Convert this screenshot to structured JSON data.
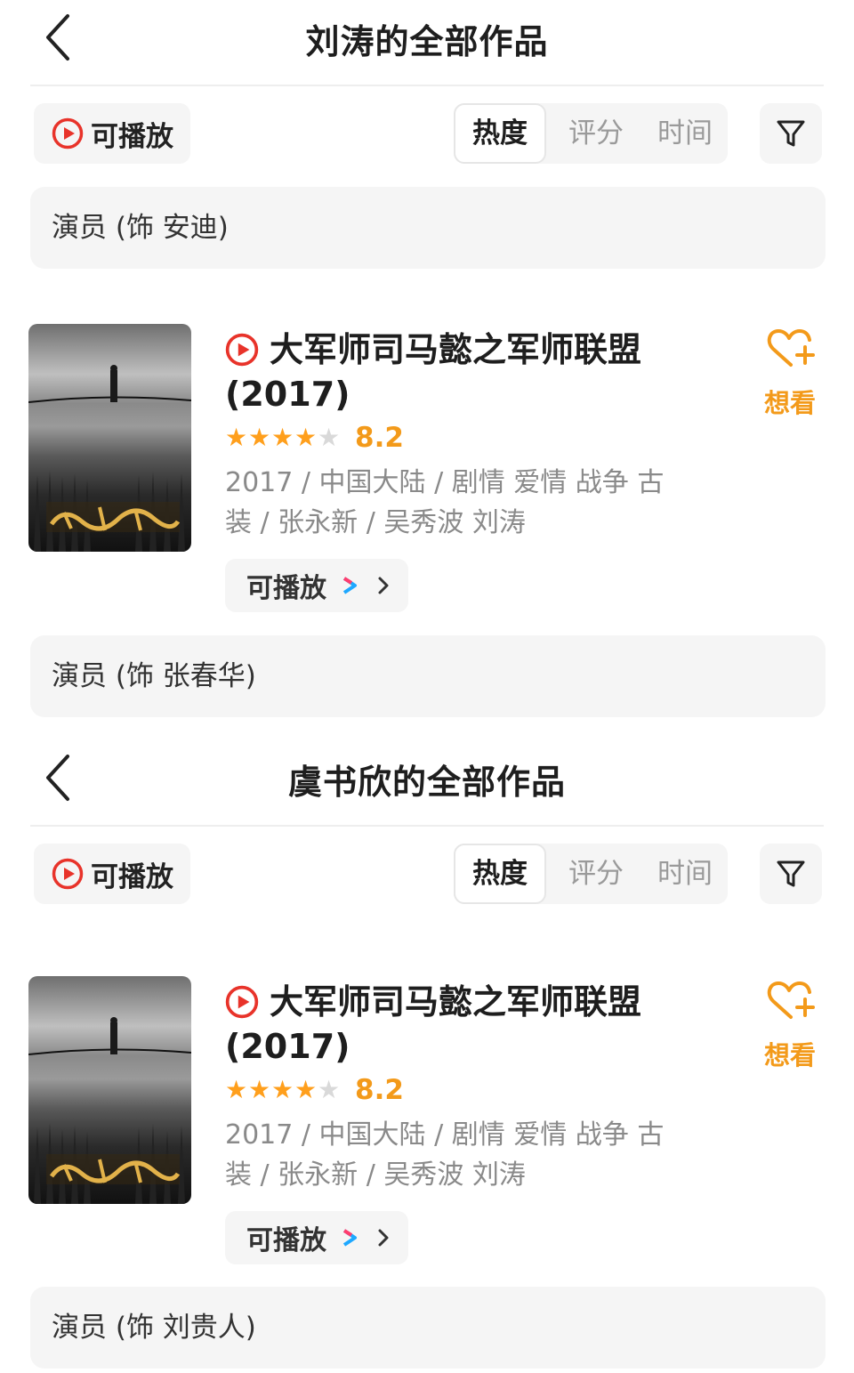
{
  "sections": [
    {
      "header": {
        "title": "刘涛的全部作品"
      },
      "toolbar": {
        "playable_label": "可播放",
        "sort": [
          "热度",
          "评分",
          "时间"
        ],
        "sort_active": "热度"
      },
      "role_top": "演员 (饰 安迪)",
      "movie": {
        "title": "大军师司马懿之军师联盟",
        "year": "(2017)",
        "stars": 4.5,
        "score": "8.2",
        "meta": "2017 / 中国大陆 / 剧情 爱情 战争 古装 / 张永新 / 吴秀波 刘涛",
        "play_label": "可播放",
        "want_label": "想看"
      },
      "role_bottom": "演员 (饰 张春华)"
    },
    {
      "header": {
        "title": "虞书欣的全部作品"
      },
      "toolbar": {
        "playable_label": "可播放",
        "sort": [
          "热度",
          "评分",
          "时间"
        ],
        "sort_active": "热度"
      },
      "movie": {
        "title": "大军师司马懿之军师联盟",
        "year": "(2017)",
        "stars": 4.5,
        "score": "8.2",
        "meta": "2017 / 中国大陆 / 剧情 爱情 战争 古装 / 张永新 / 吴秀波 刘涛",
        "play_label": "可播放",
        "want_label": "想看"
      },
      "role_bottom": "演员 (饰 刘贵人)"
    }
  ],
  "colors": {
    "accent_red": "#e8332a",
    "rating_orange": "#f39a1a",
    "chip_bg": "#f5f5f5"
  },
  "icons": [
    "back-chevron-icon",
    "play-circle-icon",
    "filter-funnel-icon",
    "heart-plus-icon",
    "youku-logo-icon",
    "chevron-right-icon"
  ]
}
